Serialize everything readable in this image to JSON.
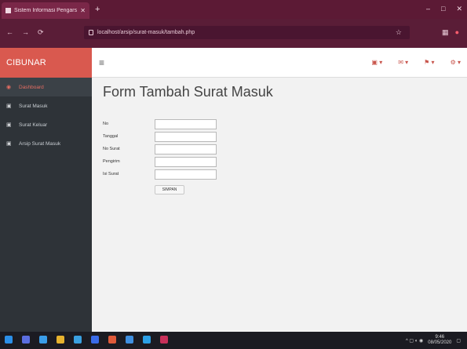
{
  "browser": {
    "tab_title": "Sistem Informasi Pengarsipan Surat - Tambah Surat",
    "new_tab": "+",
    "window_buttons": [
      "–",
      "□",
      "✕"
    ],
    "url": "localhost/arsip/surat-masuk/tambah.php",
    "nav_icons": [
      "←",
      "→",
      "⟳"
    ]
  },
  "app": {
    "brand": "CIBUNAR",
    "menu_icon": "≡",
    "top_icons": [
      "▣ ▾",
      "✉ ▾",
      "⚑ ▾",
      "⚙ ▾"
    ]
  },
  "sidebar": {
    "items": [
      {
        "icon": "◉",
        "label": "Dashboard",
        "active": true
      },
      {
        "icon": "▣",
        "label": "Surat Masuk",
        "active": false
      },
      {
        "icon": "▣",
        "label": "Surat Keluar",
        "active": false
      },
      {
        "icon": "▣",
        "label": "Arsip Surat Masuk",
        "active": false
      }
    ]
  },
  "form": {
    "title": "Form Tambah Surat Masuk",
    "fields": [
      {
        "label": "No",
        "value": ""
      },
      {
        "label": "Tanggal",
        "value": ""
      },
      {
        "label": "No Surat",
        "value": ""
      },
      {
        "label": "Pengirim",
        "value": ""
      },
      {
        "label": "Isi Surat",
        "value": ""
      }
    ],
    "submit_label": "SIMPAN"
  },
  "taskbar": {
    "time": "9:46",
    "date": "08/05/2020"
  },
  "colors": {
    "brand": "#d9594f",
    "sidebar": "#2e3338",
    "browser_chrome": "#5c1a35"
  }
}
